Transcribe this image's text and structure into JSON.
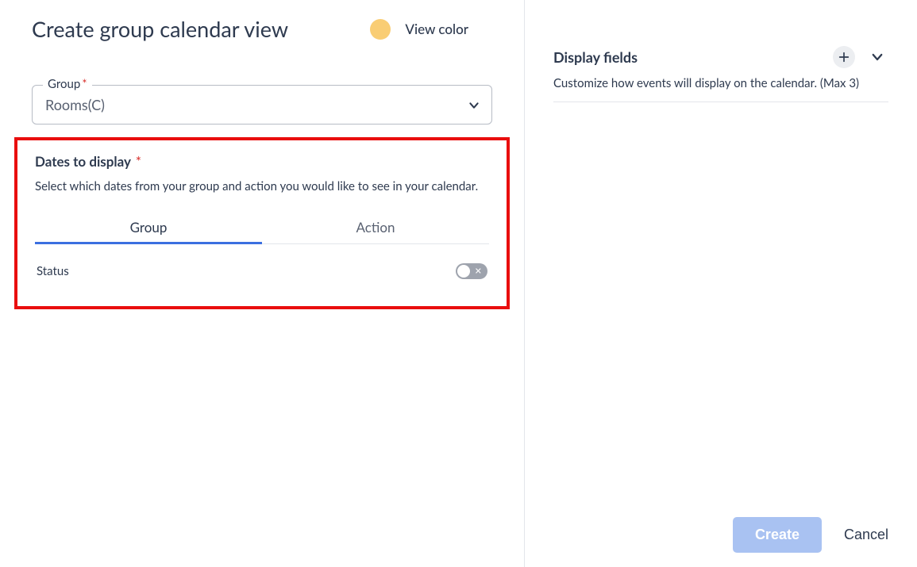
{
  "header": {
    "title": "Create group calendar view",
    "view_color_label": "View color",
    "view_color_hex": "#f9cd74"
  },
  "group_field": {
    "label": "Group",
    "required_marker": "*",
    "value": "Rooms(C)"
  },
  "dates_section": {
    "title": "Dates to display",
    "required_marker": "*",
    "description": "Select which dates from your group and action you would like to see in your calendar.",
    "tabs": [
      {
        "label": "Group",
        "active": true
      },
      {
        "label": "Action",
        "active": false
      }
    ],
    "rows": [
      {
        "label": "Status",
        "enabled": false
      }
    ]
  },
  "display_fields": {
    "title": "Display fields",
    "description": "Customize how events will display on the calendar. (Max 3)"
  },
  "footer": {
    "create_label": "Create",
    "cancel_label": "Cancel"
  }
}
